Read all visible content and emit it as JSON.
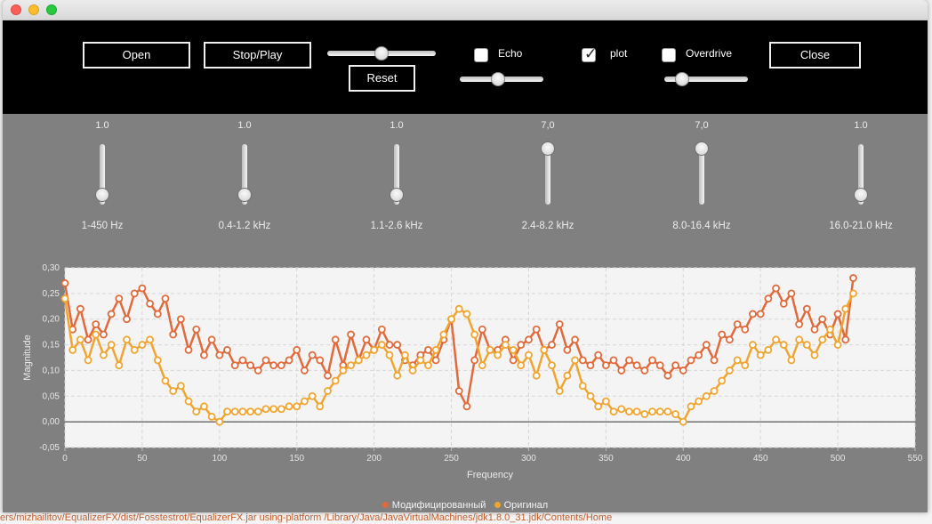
{
  "window": {
    "title": ""
  },
  "toolbar": {
    "open_label": "Open",
    "stopplay_label": "Stop/Play",
    "reset_label": "Reset",
    "close_label": "Close",
    "echo_label": "Echo",
    "echo_checked": false,
    "plot_label": "plot",
    "plot_checked": true,
    "overdrive_label": "Overdrive",
    "overdrive_checked": false,
    "checkmark": "✓",
    "volume_level": 0.5,
    "echo_level": 0.45,
    "overdrive_level": 0.15
  },
  "equalizer": {
    "bands": [
      {
        "label": "1-450 Hz",
        "value": "1.0",
        "level": 0.05
      },
      {
        "label": "0.4-1.2 kHz",
        "value": "1.0",
        "level": 0.05
      },
      {
        "label": "1.1-2.6 kHz",
        "value": "1.0",
        "level": 0.05
      },
      {
        "label": "2.4-8.2 kHz",
        "value": "7,0",
        "level": 0.98
      },
      {
        "label": "8.0-16.4 kHz",
        "value": "7,0",
        "level": 0.98
      },
      {
        "label": "16.0-21.0 kHz",
        "value": "1.0",
        "level": 0.05
      }
    ]
  },
  "chart_data": {
    "type": "line",
    "xlabel": "Frequency",
    "ylabel": "Magnitude",
    "xlim": [
      0,
      550
    ],
    "ylim": [
      -0.05,
      0.3
    ],
    "xticks": [
      "0",
      "50",
      "100",
      "150",
      "200",
      "250",
      "300",
      "350",
      "400",
      "450",
      "500",
      "550"
    ],
    "yticks": [
      "-0,05",
      "0,00",
      "0,05",
      "0,10",
      "0,15",
      "0,20",
      "0,25",
      "0,30"
    ],
    "grid": true,
    "legend_position": "bottom",
    "series": [
      {
        "name": "Модифицированный",
        "color": "#e06a3b",
        "x": [
          0,
          5,
          10,
          15,
          20,
          25,
          30,
          35,
          40,
          45,
          50,
          55,
          60,
          65,
          70,
          75,
          80,
          85,
          90,
          95,
          100,
          105,
          110,
          115,
          120,
          125,
          130,
          135,
          140,
          145,
          150,
          155,
          160,
          165,
          170,
          175,
          180,
          185,
          190,
          195,
          200,
          205,
          210,
          215,
          220,
          225,
          230,
          235,
          240,
          245,
          250,
          255,
          260,
          265,
          270,
          275,
          280,
          285,
          290,
          295,
          300,
          305,
          310,
          315,
          320,
          325,
          330,
          335,
          340,
          345,
          350,
          355,
          360,
          365,
          370,
          375,
          380,
          385,
          390,
          395,
          400,
          405,
          410,
          415,
          420,
          425,
          430,
          435,
          440,
          445,
          450,
          455,
          460,
          465,
          470,
          475,
          480,
          485,
          490,
          495,
          500,
          505,
          510
        ],
        "values": [
          0.27,
          0.18,
          0.22,
          0.16,
          0.19,
          0.17,
          0.21,
          0.24,
          0.2,
          0.25,
          0.26,
          0.23,
          0.21,
          0.24,
          0.17,
          0.2,
          0.14,
          0.18,
          0.13,
          0.16,
          0.13,
          0.14,
          0.11,
          0.12,
          0.11,
          0.1,
          0.12,
          0.11,
          0.11,
          0.12,
          0.14,
          0.1,
          0.13,
          0.12,
          0.09,
          0.16,
          0.11,
          0.17,
          0.12,
          0.16,
          0.14,
          0.18,
          0.15,
          0.15,
          0.12,
          0.11,
          0.13,
          0.14,
          0.12,
          0.16,
          0.2,
          0.06,
          0.03,
          0.12,
          0.18,
          0.14,
          0.14,
          0.16,
          0.12,
          0.15,
          0.16,
          0.18,
          0.14,
          0.15,
          0.19,
          0.14,
          0.16,
          0.12,
          0.11,
          0.13,
          0.11,
          0.12,
          0.1,
          0.12,
          0.11,
          0.1,
          0.12,
          0.11,
          0.09,
          0.11,
          0.1,
          0.12,
          0.13,
          0.15,
          0.12,
          0.17,
          0.16,
          0.19,
          0.18,
          0.21,
          0.21,
          0.24,
          0.26,
          0.23,
          0.25,
          0.19,
          0.22,
          0.18,
          0.2,
          0.17,
          0.21,
          0.16,
          0.28
        ]
      },
      {
        "name": "Оригинал",
        "color": "#f0a530",
        "x": [
          0,
          5,
          10,
          15,
          20,
          25,
          30,
          35,
          40,
          45,
          50,
          55,
          60,
          65,
          70,
          75,
          80,
          85,
          90,
          95,
          100,
          105,
          110,
          115,
          120,
          125,
          130,
          135,
          140,
          145,
          150,
          155,
          160,
          165,
          170,
          175,
          180,
          185,
          190,
          195,
          200,
          205,
          210,
          215,
          220,
          225,
          230,
          235,
          240,
          245,
          250,
          255,
          260,
          265,
          270,
          275,
          280,
          285,
          290,
          295,
          300,
          305,
          310,
          315,
          320,
          325,
          330,
          335,
          340,
          345,
          350,
          355,
          360,
          365,
          370,
          375,
          380,
          385,
          390,
          395,
          400,
          405,
          410,
          415,
          420,
          425,
          430,
          435,
          440,
          445,
          450,
          455,
          460,
          465,
          470,
          475,
          480,
          485,
          490,
          495,
          500,
          505,
          510
        ],
        "values": [
          0.24,
          0.14,
          0.16,
          0.12,
          0.17,
          0.13,
          0.15,
          0.11,
          0.16,
          0.14,
          0.15,
          0.16,
          0.12,
          0.08,
          0.06,
          0.07,
          0.04,
          0.02,
          0.03,
          0.01,
          0.0,
          0.02,
          0.02,
          0.02,
          0.02,
          0.02,
          0.025,
          0.025,
          0.025,
          0.03,
          0.03,
          0.04,
          0.05,
          0.03,
          0.06,
          0.08,
          0.1,
          0.11,
          0.12,
          0.13,
          0.14,
          0.15,
          0.13,
          0.09,
          0.13,
          0.1,
          0.12,
          0.11,
          0.14,
          0.17,
          0.2,
          0.22,
          0.21,
          0.17,
          0.11,
          0.14,
          0.13,
          0.15,
          0.14,
          0.11,
          0.13,
          0.09,
          0.14,
          0.11,
          0.06,
          0.09,
          0.12,
          0.07,
          0.05,
          0.03,
          0.04,
          0.02,
          0.025,
          0.02,
          0.02,
          0.015,
          0.02,
          0.02,
          0.02,
          0.015,
          0.0,
          0.03,
          0.04,
          0.05,
          0.06,
          0.08,
          0.1,
          0.12,
          0.11,
          0.15,
          0.13,
          0.14,
          0.16,
          0.15,
          0.12,
          0.16,
          0.15,
          0.13,
          0.16,
          0.18,
          0.15,
          0.22,
          0.25
        ]
      }
    ]
  },
  "background": {
    "bottom_text": "ers/mizhailitov/EqualizerFX/dist/Fosstestrot/EqualizerFX.jar using-platform /Library/Java/JavaVirtualMachines/jdk1.8.0_31.jdk/Contents/Home"
  }
}
